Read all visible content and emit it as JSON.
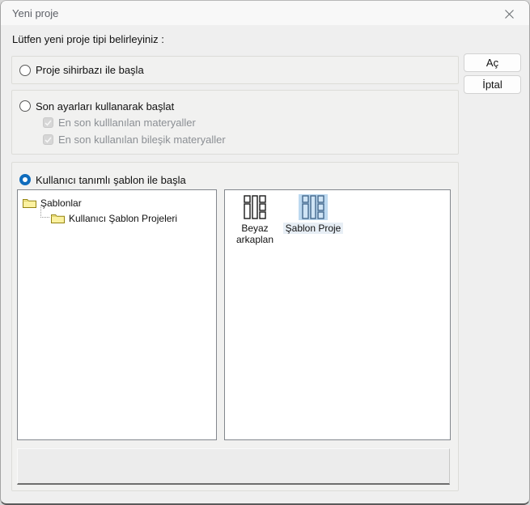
{
  "window": {
    "title": "Yeni proje"
  },
  "icons": {
    "close": "✕",
    "folder": "folder-icon",
    "template": "panel-layout-icon",
    "check": "check-icon"
  },
  "intro": "Lütfen yeni proje tipi belirleyiniz :",
  "actions": {
    "open": "Aç",
    "cancel": "İptal"
  },
  "options": {
    "wizard": {
      "label": "Proje sihirbazı ile başla",
      "selected": false
    },
    "last_settings": {
      "label": "Son ayarları kullanarak başlat",
      "selected": false
    },
    "sub_last_materials": {
      "label": "En son kulllanılan materyaller",
      "checked": true,
      "enabled": false
    },
    "sub_last_composites": {
      "label": "En son kullanılan bileşik materyaller",
      "checked": true,
      "enabled": false
    },
    "user_template": {
      "label": "Kullanıcı tanımlı şablon ile başla",
      "selected": true
    }
  },
  "tree": {
    "root": "Şablonlar",
    "child": "Kullanıcı Şablon Projeleri"
  },
  "templates": [
    {
      "label": "Beyaz arkaplan",
      "selected": false
    },
    {
      "label": "Şablon Proje",
      "selected": true
    }
  ],
  "colors": {
    "accent": "#0f6cbd",
    "selection_bg": "#bdd9f0",
    "selection_label_bg": "#e7eef5"
  }
}
